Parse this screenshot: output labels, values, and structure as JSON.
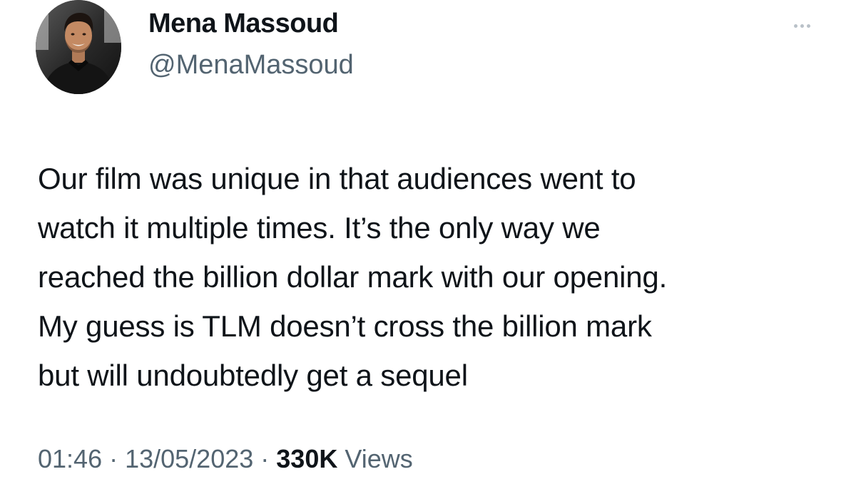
{
  "author": {
    "display_name": "Mena Massoud",
    "handle": "@MenaMassoud",
    "avatar_icon": "profile-photo"
  },
  "more_icon": "more-horizontal-icon",
  "tweet": {
    "lines": [
      "Our film was unique in that audiences went to",
      "watch it multiple times. It’s the only way we",
      "reached the billion dollar mark with our opening.",
      "My guess is TLM doesn’t cross the billion mark",
      "but will undoubtedly get a sequel"
    ]
  },
  "meta": {
    "time": "01:46",
    "separator": " · ",
    "date": "13/05/2023",
    "views_count": "330K",
    "views_label": " Views"
  },
  "colors": {
    "primary_text": "#0f1419",
    "secondary_text": "#536471",
    "background": "#ffffff"
  }
}
